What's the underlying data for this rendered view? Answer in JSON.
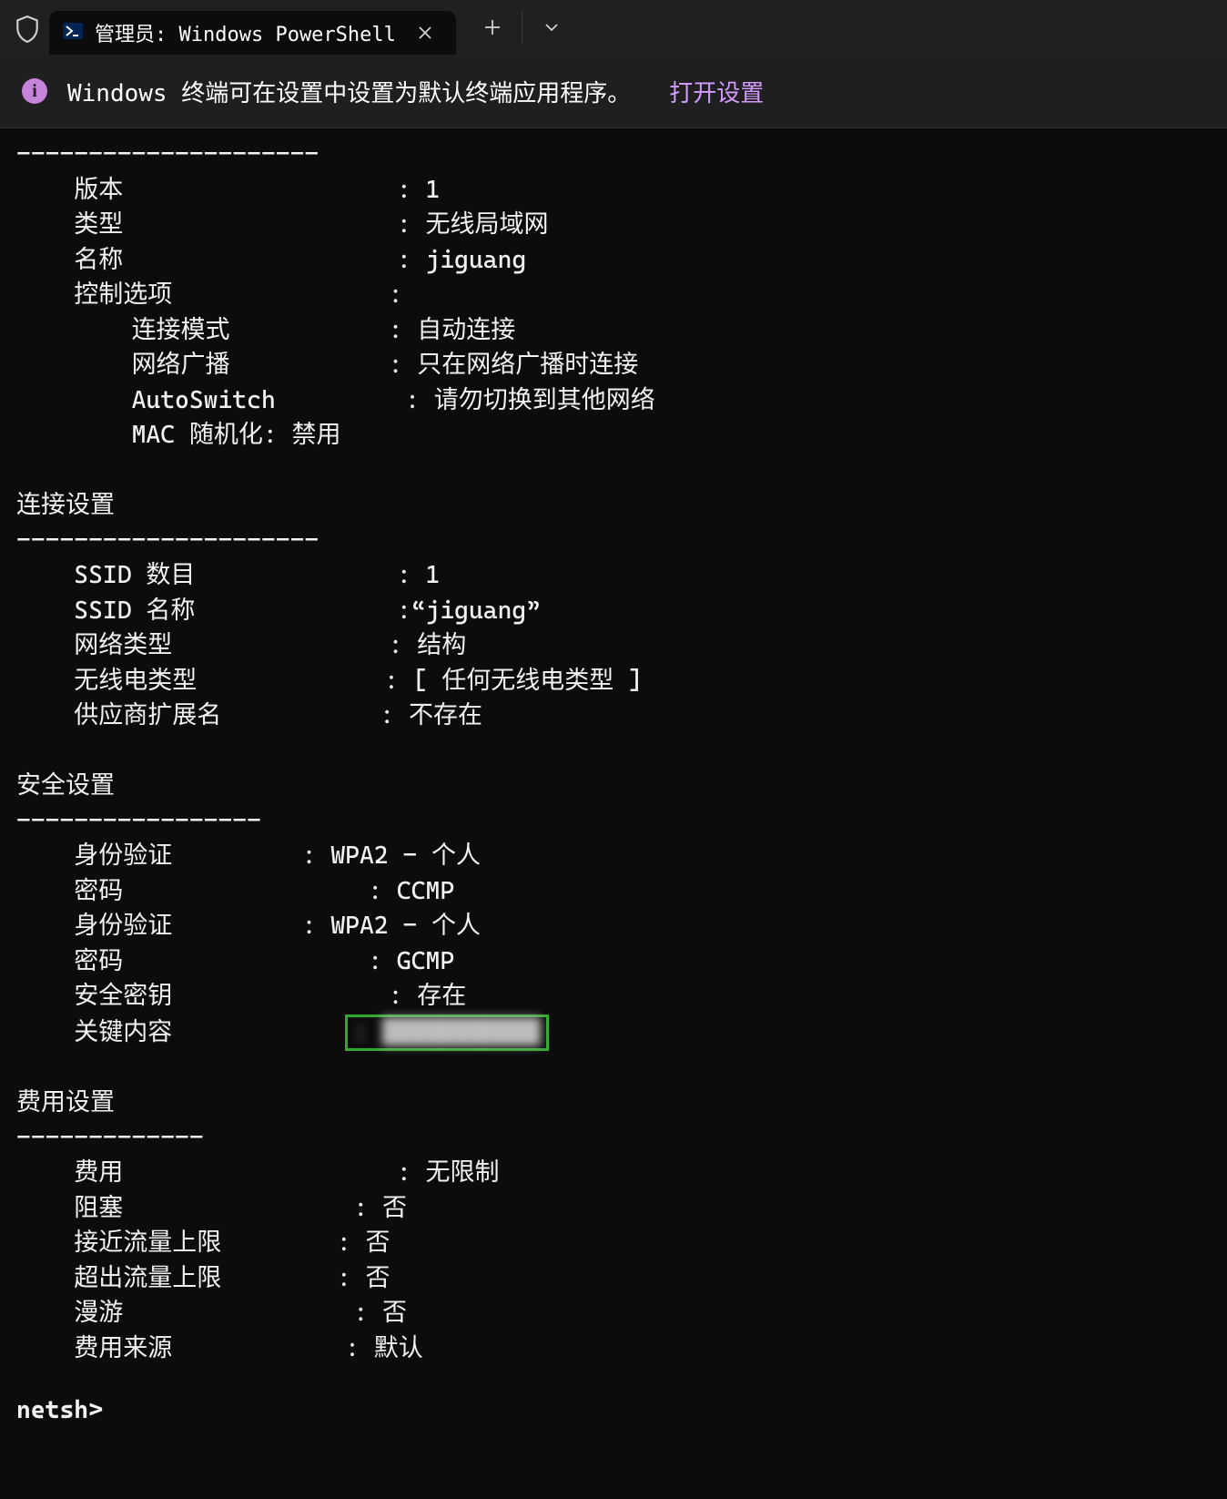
{
  "titlebar": {
    "tab_title": "管理员: Windows PowerShell"
  },
  "infobar": {
    "message": "Windows 终端可在设置中设置为默认终端应用程序。",
    "link": "打开设置"
  },
  "terminal": {
    "divider1": "---------------------",
    "version_label": "    版本                   : ",
    "version_value": "1",
    "type_label": "    类型                   : ",
    "type_value": "无线局域网",
    "name_label": "    名称                   : ",
    "name_value": "jiguang",
    "ctrl_label": "    控制选项               :",
    "conn_mode_label": "        连接模式           : ",
    "conn_mode_value": "自动连接",
    "broadcast_label": "        网络广播           : ",
    "broadcast_value": "只在网络广播时连接",
    "autoswitch_label": "        AutoSwitch         : ",
    "autoswitch_value": "请勿切换到其他网络",
    "mac_line": "        MAC 随机化: 禁用",
    "conn_heading": "连接设置",
    "divider2": "---------------------",
    "ssid_count_label": "    SSID 数目              : ",
    "ssid_count_value": "1",
    "ssid_name_label": "    SSID 名称              :",
    "ssid_name_value": "“jiguang”",
    "net_type_label": "    网络类型               : ",
    "net_type_value": "结构",
    "radio_label": "    无线电类型             : ",
    "radio_value": "[ 任何无线电类型 ]",
    "vendor_label": "    供应商扩展名           : ",
    "vendor_value": "不存在",
    "sec_heading": "安全设置",
    "divider3": "-----------------",
    "auth1_label": "    身份验证         : ",
    "auth1_value": "WPA2 - 个人",
    "cipher1_label": "    密码                 : ",
    "cipher1_value": "CCMP",
    "auth2_label": "    身份验证         : ",
    "auth2_value": "WPA2 - 个人",
    "cipher2_label": "    密码                 : ",
    "cipher2_value": "GCMP",
    "seckey_label": "    安全密钥               : ",
    "seckey_value": "存在",
    "keycontent_label": "    关键内容            ",
    "keycontent_value": ": ███████████",
    "cost_heading": "费用设置",
    "divider4": "-------------",
    "cost_label": "    费用                   : ",
    "cost_value": "无限制",
    "congested_label": "    阻塞                : ",
    "congested_value": "否",
    "near_label": "    接近流量上限        : ",
    "near_value": "否",
    "over_label": "    超出流量上限        : ",
    "over_value": "否",
    "roaming_label": "    漫游                : ",
    "roaming_value": "否",
    "costsrc_label": "    费用来源            : ",
    "costsrc_value": "默认",
    "prompt": "netsh>"
  }
}
